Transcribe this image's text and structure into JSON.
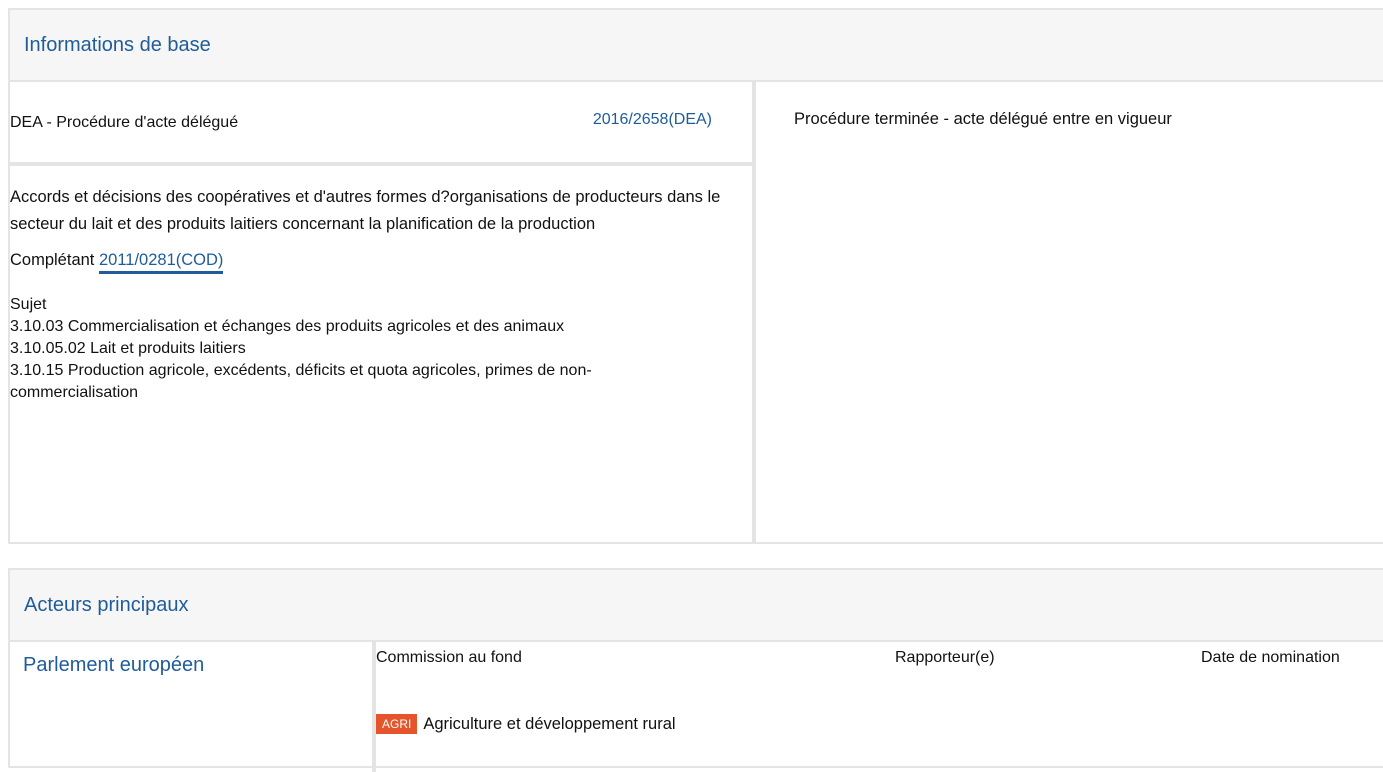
{
  "basic_info": {
    "title": "Informations de base",
    "procedure_type": "DEA - Procédure d'acte délégué",
    "procedure_ref": "2016/2658(DEA)",
    "description": "Accords et décisions des coopératives et d'autres formes d?organisations de producteurs dans le secteur du lait et des produits laitiers concernant la planification de la production",
    "complement_label": "Complétant",
    "complement_ref": "2011/0281(COD)",
    "subject_label": "Sujet",
    "subjects": [
      "3.10.03 Commercialisation et échanges des produits agricoles et des animaux",
      "3.10.05.02 Lait et produits laitiers",
      "3.10.15 Production agricole, excédents, déficits et quota agricoles, primes de non-commercialisation"
    ],
    "status": "Procédure terminée - acte délégué entre en vigueur"
  },
  "actors": {
    "title": "Acteurs principaux",
    "institution": "Parlement européen",
    "columns": [
      "Commission au fond",
      "Rapporteur(e)",
      "Date de nomination"
    ],
    "committee": {
      "badge": "AGRI",
      "name": "Agriculture et développement rural"
    }
  },
  "colors": {
    "accent": "#1f5c99",
    "badge": "#e5542a",
    "border": "#e4e4e4"
  }
}
